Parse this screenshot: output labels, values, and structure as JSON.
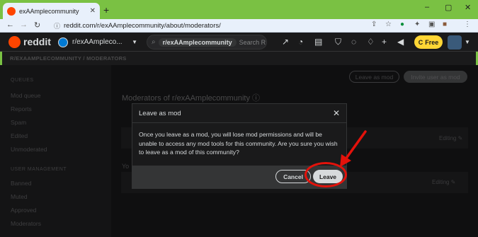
{
  "browser": {
    "tab_title": "exAAmplecommunity",
    "tab_close": "✕",
    "new_tab": "+",
    "url": "reddit.com/r/exAAmplecommunity/about/moderators/",
    "back_glyph": "←",
    "forward_glyph": "→",
    "reload_glyph": "↻",
    "icons": [
      "info-icon",
      "share-icon",
      "star-icon",
      "extension-g-icon",
      "puzzle-icon",
      "sidepanel-icon",
      "profile-icon",
      "menu-icon"
    ],
    "window_controls": [
      "–",
      "▢",
      "✕"
    ]
  },
  "header": {
    "logo_text": "reddit",
    "community": "r/exAAmpleco...",
    "search_pill": "r/exAAmplecommunity",
    "search_placeholder": "Search R",
    "free_label": "Free",
    "coin_glyph": "C"
  },
  "page": {
    "breadcrumb": "R/EXAAMPLECOMMUNITY / MODERATORS",
    "sidebar": {
      "queues_head": "QUEUES",
      "items_top": [
        "Mod queue",
        "Reports",
        "Spam",
        "Edited",
        "Unmoderated"
      ],
      "user_head": "USER MANAGEMENT",
      "items_bottom": [
        "Banned",
        "Muted",
        "Approved",
        "Moderators"
      ]
    },
    "leave_as_mod_label": "Leave as mod",
    "invite_label": "Invite user as mod",
    "mods_title": "Moderators of r/exAAmplecommunity ⓘ",
    "row_prefix": "Yo",
    "edit_label": "Editing ✎"
  },
  "modal": {
    "title": "Leave as mod",
    "body": "Once you leave as a mod, you will lose mod permissions and will be unable to access any mod tools for this community. Are you sure you wish to leave as a mod of this community?",
    "cancel_label": "Cancel",
    "leave_label": "Leave"
  },
  "colors": {
    "browser_frame": "#7ac143",
    "reddit_orange": "#ff4500",
    "annotation_red": "#e3120b",
    "modal_bg": "#1a1a1b"
  }
}
